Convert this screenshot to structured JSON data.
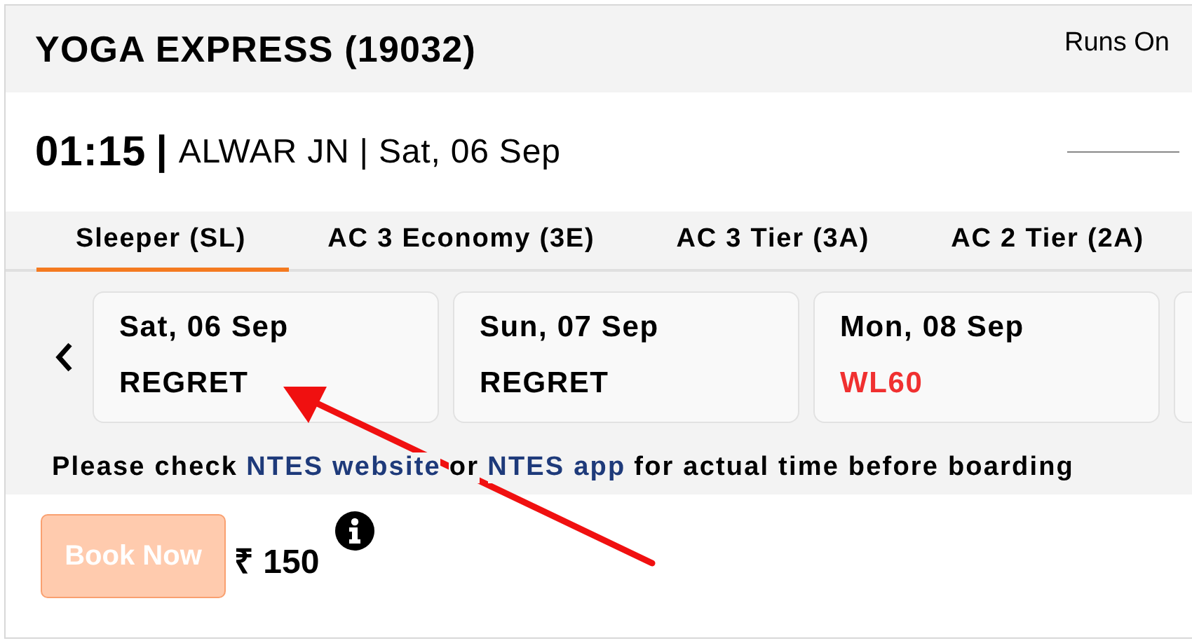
{
  "train": {
    "title": "YOGA EXPRESS (19032)",
    "runs_on": "Runs On"
  },
  "departure": {
    "time": "01:15",
    "separator": "|",
    "station": "ALWAR JN | Sat, 06 Sep"
  },
  "tabs": [
    {
      "label": "Sleeper (SL)",
      "selected": true
    },
    {
      "label": "AC 3 Economy (3E)",
      "selected": false
    },
    {
      "label": "AC 3 Tier (3A)",
      "selected": false
    },
    {
      "label": "AC 2 Tier (2A)",
      "selected": false
    }
  ],
  "dates": [
    {
      "date": "Sat, 06 Sep",
      "status": "REGRET",
      "kind": "regret"
    },
    {
      "date": "Sun, 07 Sep",
      "status": "REGRET",
      "kind": "regret"
    },
    {
      "date": "Mon, 08 Sep",
      "status": "WL60",
      "kind": "waitlist"
    }
  ],
  "note": {
    "before": "Please check",
    "link1": "NTES website",
    "middle": "or",
    "link2": "NTES app",
    "after": "for actual time before boarding"
  },
  "booking": {
    "button": "Book Now",
    "disabled": true,
    "price": "₹ 150"
  }
}
